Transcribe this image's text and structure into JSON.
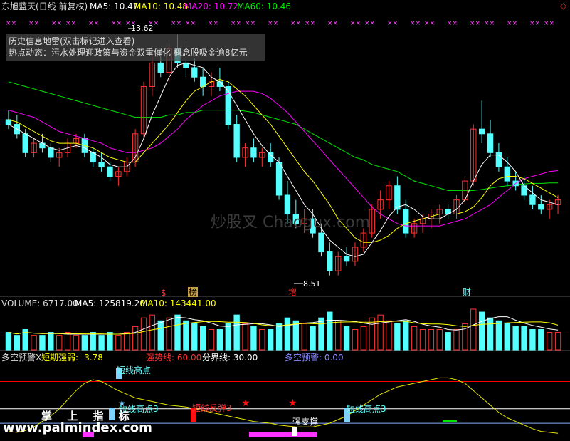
{
  "header": {
    "stock": "东旭蓝天(日线 前复权)",
    "ma5": "MA5: 10.47",
    "ma10": "MA10: 10.48",
    "ma20": "MA20: 10.72",
    "ma60": "MA60: 10.46",
    "diamond": "◇"
  },
  "news": {
    "line1": "历史信息地雷(双击标记进入查看)",
    "line2": "热点动态：污水处理迎政策与资金双重催化 概念股吸金逾8亿元"
  },
  "price_labels": {
    "high": "13.62",
    "low": "8.51"
  },
  "markers": {
    "s": "$",
    "bang": "榜",
    "zeng": "增",
    "cai": "财"
  },
  "volume_header": {
    "vol": "VOLUME: 6717.00",
    "ma5": "MA5: 125819.20",
    "ma10": "MA10: 143441.00"
  },
  "indicator_header": {
    "name": "多空预警X",
    "short": "短期强弱: -3.78",
    "strong": "强势线: 60.00",
    "boundary": "分界线: 30.00",
    "warn": "多空预警: 0.00"
  },
  "indicator_labels": {
    "hp1": "短线高点",
    "hp2": "短线高点3",
    "rebound": "短线反弹3",
    "hp3": "短线高点3",
    "support": "强支撑"
  },
  "watermark": "炒股叉 Chaogux.com",
  "palm": "掌 上 指 标",
  "site": "www.palmindex.com",
  "colors": {
    "bg": "#000000",
    "up": "#ff3232",
    "down": "#54ffff",
    "ma5": "#ffffff",
    "ma10": "#ffff00",
    "ma20": "#ff00ff",
    "ma60": "#00e600",
    "short": "#e6e600",
    "strong": "#ff0000",
    "boundary": "#ffffff",
    "warn": "#8080ff"
  },
  "chart_data": {
    "type": "candlestick",
    "ylim": [
      8.3,
      14.0
    ],
    "candles": [
      [
        11.8,
        12.0,
        11.6,
        11.7
      ],
      [
        11.7,
        11.9,
        11.4,
        11.5
      ],
      [
        11.5,
        11.6,
        11.0,
        11.1
      ],
      [
        11.1,
        11.4,
        11.0,
        11.3
      ],
      [
        11.3,
        11.5,
        11.1,
        11.2
      ],
      [
        11.2,
        11.3,
        10.9,
        11.0
      ],
      [
        11.0,
        11.2,
        10.8,
        11.1
      ],
      [
        11.1,
        11.4,
        11.0,
        11.3
      ],
      [
        11.3,
        11.5,
        11.2,
        11.4
      ],
      [
        11.4,
        11.5,
        11.0,
        11.1
      ],
      [
        11.1,
        11.2,
        10.8,
        10.9
      ],
      [
        10.9,
        11.1,
        10.7,
        10.8
      ],
      [
        10.8,
        10.9,
        10.5,
        10.6
      ],
      [
        10.6,
        10.8,
        10.4,
        10.7
      ],
      [
        10.7,
        11.0,
        10.6,
        10.9
      ],
      [
        10.9,
        11.6,
        10.8,
        11.5
      ],
      [
        11.5,
        12.6,
        11.4,
        12.5
      ],
      [
        12.5,
        13.2,
        12.3,
        13.0
      ],
      [
        13.0,
        13.3,
        12.7,
        12.8
      ],
      [
        12.8,
        13.4,
        12.6,
        13.3
      ],
      [
        13.3,
        13.6,
        12.9,
        13.0
      ],
      [
        13.0,
        13.4,
        12.7,
        12.9
      ],
      [
        12.9,
        13.1,
        12.6,
        12.7
      ],
      [
        12.7,
        12.9,
        12.3,
        12.5
      ],
      [
        12.5,
        12.8,
        12.3,
        12.6
      ],
      [
        12.6,
        12.9,
        12.4,
        12.5
      ],
      [
        12.5,
        12.6,
        11.6,
        11.7
      ],
      [
        11.7,
        11.9,
        10.9,
        11.0
      ],
      [
        11.0,
        11.3,
        10.8,
        11.2
      ],
      [
        11.2,
        11.4,
        10.9,
        11.0
      ],
      [
        11.0,
        11.2,
        10.8,
        11.1
      ],
      [
        11.1,
        11.3,
        10.8,
        10.9
      ],
      [
        10.9,
        11.0,
        10.1,
        10.2
      ],
      [
        10.2,
        10.5,
        9.6,
        9.8
      ],
      [
        9.8,
        10.1,
        9.5,
        9.6
      ],
      [
        9.6,
        9.9,
        9.4,
        9.7
      ],
      [
        9.7,
        9.9,
        9.3,
        9.4
      ],
      [
        9.4,
        9.6,
        8.9,
        9.0
      ],
      [
        9.0,
        9.2,
        8.5,
        8.6
      ],
      [
        8.6,
        9.0,
        8.5,
        8.9
      ],
      [
        8.9,
        9.1,
        8.7,
        8.8
      ],
      [
        8.8,
        9.2,
        8.7,
        9.1
      ],
      [
        9.1,
        9.5,
        9.0,
        9.4
      ],
      [
        9.4,
        10.0,
        9.3,
        9.9
      ],
      [
        9.9,
        10.3,
        9.7,
        10.1
      ],
      [
        10.1,
        10.5,
        9.9,
        10.4
      ],
      [
        10.4,
        10.6,
        9.8,
        9.9
      ],
      [
        9.9,
        10.1,
        9.3,
        9.4
      ],
      [
        9.4,
        9.7,
        9.3,
        9.6
      ],
      [
        9.6,
        9.8,
        9.4,
        9.7
      ],
      [
        9.7,
        9.9,
        9.5,
        9.8
      ],
      [
        9.8,
        10.0,
        9.6,
        9.9
      ],
      [
        9.9,
        10.0,
        9.7,
        9.8
      ],
      [
        9.8,
        10.2,
        9.7,
        10.1
      ],
      [
        10.1,
        10.6,
        10.0,
        10.5
      ],
      [
        10.5,
        11.7,
        10.4,
        11.6
      ],
      [
        11.6,
        12.2,
        11.3,
        11.5
      ],
      [
        11.5,
        11.8,
        11.0,
        11.1
      ],
      [
        11.1,
        11.3,
        10.7,
        10.8
      ],
      [
        10.8,
        11.0,
        10.4,
        10.5
      ],
      [
        10.5,
        10.7,
        10.3,
        10.4
      ],
      [
        10.4,
        10.6,
        10.1,
        10.2
      ],
      [
        10.2,
        10.4,
        9.9,
        10.0
      ],
      [
        10.0,
        10.2,
        9.8,
        9.9
      ],
      [
        9.9,
        10.1,
        9.7,
        10.0
      ],
      [
        10.0,
        10.2,
        9.8,
        10.1
      ]
    ],
    "ma5": [
      11.7,
      11.6,
      11.5,
      11.4,
      11.3,
      11.2,
      11.15,
      11.2,
      11.25,
      11.2,
      11.1,
      11.0,
      10.85,
      10.8,
      10.8,
      11.0,
      11.4,
      11.9,
      12.3,
      12.7,
      12.95,
      13.0,
      12.95,
      12.9,
      12.7,
      12.6,
      12.4,
      12.1,
      11.8,
      11.5,
      11.25,
      11.05,
      10.9,
      10.6,
      10.3,
      10.0,
      9.8,
      9.5,
      9.25,
      9.1,
      8.95,
      8.9,
      8.95,
      9.2,
      9.45,
      9.75,
      9.95,
      10.0,
      9.9,
      9.75,
      9.7,
      9.7,
      9.8,
      9.9,
      10.1,
      10.5,
      10.85,
      11.05,
      11.05,
      10.9,
      10.7,
      10.4,
      10.25,
      10.1,
      10.05,
      10.0
    ],
    "ma10": [
      11.8,
      11.75,
      11.65,
      11.55,
      11.45,
      11.35,
      11.3,
      11.3,
      11.3,
      11.25,
      11.2,
      11.1,
      11.0,
      10.95,
      10.9,
      10.9,
      11.1,
      11.3,
      11.5,
      11.7,
      11.95,
      12.2,
      12.4,
      12.5,
      12.6,
      12.65,
      12.6,
      12.45,
      12.3,
      12.1,
      11.9,
      11.7,
      11.45,
      11.2,
      10.95,
      10.7,
      10.5,
      10.25,
      10.0,
      9.7,
      9.5,
      9.3,
      9.2,
      9.2,
      9.25,
      9.35,
      9.5,
      9.6,
      9.65,
      9.7,
      9.75,
      9.8,
      9.8,
      9.8,
      9.85,
      9.95,
      10.15,
      10.4,
      10.55,
      10.6,
      10.6,
      10.55,
      10.45,
      10.35,
      10.25,
      10.15
    ],
    "ma20": [
      12.0,
      11.95,
      11.9,
      11.85,
      11.75,
      11.65,
      11.55,
      11.5,
      11.45,
      11.4,
      11.35,
      11.3,
      11.2,
      11.15,
      11.1,
      11.1,
      11.15,
      11.2,
      11.3,
      11.45,
      11.6,
      11.8,
      11.95,
      12.1,
      12.2,
      12.3,
      12.35,
      12.4,
      12.4,
      12.4,
      12.35,
      12.25,
      12.1,
      11.95,
      11.75,
      11.55,
      11.35,
      11.15,
      10.95,
      10.75,
      10.55,
      10.35,
      10.15,
      9.95,
      9.8,
      9.7,
      9.6,
      9.55,
      9.55,
      9.55,
      9.55,
      9.55,
      9.6,
      9.65,
      9.7,
      9.8,
      9.9,
      10.0,
      10.15,
      10.3,
      10.45,
      10.55,
      10.6,
      10.65,
      10.7,
      10.72
    ],
    "ma60": [
      12.6,
      12.55,
      12.5,
      12.45,
      12.4,
      12.35,
      12.3,
      12.25,
      12.2,
      12.15,
      12.1,
      12.05,
      12.0,
      11.95,
      11.9,
      11.85,
      11.85,
      11.85,
      11.85,
      11.9,
      11.9,
      11.95,
      11.95,
      12.0,
      12.0,
      12.0,
      12.0,
      12.0,
      11.98,
      11.95,
      11.9,
      11.85,
      11.8,
      11.75,
      11.7,
      11.6,
      11.5,
      11.4,
      11.3,
      11.2,
      11.1,
      11.0,
      10.95,
      10.85,
      10.8,
      10.75,
      10.7,
      10.6,
      10.5,
      10.45,
      10.4,
      10.35,
      10.3,
      10.3,
      10.3,
      10.3,
      10.32,
      10.35,
      10.38,
      10.4,
      10.42,
      10.44,
      10.45,
      10.45,
      10.46,
      10.46
    ],
    "volume": [
      6,
      5,
      7,
      5,
      5,
      6,
      5,
      6,
      5,
      5,
      6,
      5,
      6,
      5,
      6,
      8,
      11,
      12,
      10,
      11,
      12,
      10,
      9,
      8,
      7,
      7,
      9,
      12,
      9,
      8,
      7,
      7,
      9,
      11,
      10,
      9,
      8,
      11,
      13,
      10,
      8,
      7,
      8,
      11,
      12,
      10,
      9,
      10,
      8,
      7,
      7,
      7,
      6,
      7,
      9,
      14,
      13,
      11,
      10,
      9,
      8,
      8,
      7,
      7,
      6,
      6
    ],
    "short_strength": [
      5,
      4,
      6,
      10,
      16,
      22,
      30,
      40,
      50,
      58,
      62,
      60,
      55,
      50,
      46,
      42,
      40,
      38,
      36,
      34,
      33,
      32,
      30,
      28,
      26,
      24,
      22,
      20,
      18,
      16,
      15,
      14,
      12,
      11,
      10,
      10,
      10,
      12,
      14,
      18,
      22,
      28,
      34,
      40,
      46,
      50,
      54,
      56,
      58,
      60,
      62,
      64,
      64,
      62,
      58,
      50,
      42,
      34,
      26,
      20,
      16,
      12,
      8,
      5,
      4,
      3
    ],
    "ylim_indicator": [
      0,
      80
    ],
    "strong_line": 60,
    "boundary": 30,
    "warn": 0
  }
}
